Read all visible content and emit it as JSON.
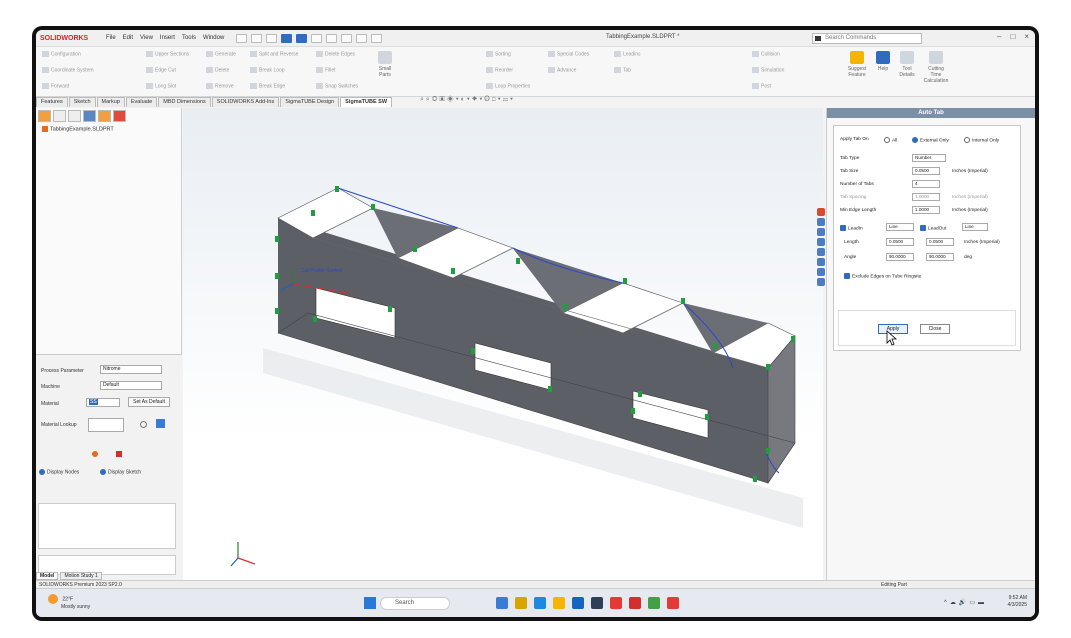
{
  "app": {
    "logo": "SOLIDWORKS",
    "menu": [
      "File",
      "Edit",
      "View",
      "Insert",
      "Tools",
      "Window"
    ],
    "doc_title": "TabbingExample.SLDPRT *",
    "search_placeholder": "Search Commands",
    "window_controls": [
      "–",
      "□",
      "×"
    ]
  },
  "ribbon": {
    "small_buttons": [
      "Configuration",
      "Coordinate System",
      "Forward",
      "Upper Sections",
      "Edge Cut",
      "Long Slot",
      "Generate",
      "Delete",
      "Remove",
      "Split and Reverse",
      "Break Loop",
      "Break Edge",
      "Delete Edges",
      "Fillet",
      "Snap Switches",
      "Sorting",
      "Reorder",
      "Loop Properties",
      "Special Codes",
      "Advance",
      "Leadins",
      "Tab",
      "Collision",
      "Simulation",
      "Post"
    ],
    "large_buttons": [
      {
        "label": "Small Parts",
        "style": ""
      },
      {
        "label": "Suggest Feature",
        "style": "active"
      },
      {
        "label": "Help",
        "style": "blue"
      },
      {
        "label": "Tool Details",
        "style": ""
      },
      {
        "label": "Cutting Time Calculation",
        "style": ""
      }
    ]
  },
  "tabs": [
    "Features",
    "Sketch",
    "Markup",
    "Evaluate",
    "MBD Dimensions",
    "SOLIDWORKS Add-Ins",
    "SigmaTUBE Design",
    "SigmaTUBE SW"
  ],
  "active_tab": "SigmaTUBE SW",
  "tree": {
    "root": "TabbingExample.SLDPRT"
  },
  "process": {
    "process_parameter_label": "Process Parameter",
    "process_parameter_value": "Nitrome",
    "machine_label": "Machine",
    "machine_value": "Default",
    "material_label": "Material",
    "material_value": "SS",
    "set_as_default": "Set As Default",
    "material_lookup_label": "Material Lookup",
    "display_nodes": "Display Nodes",
    "display_sketch": "Display Sketch"
  },
  "viewport": {
    "annotation": "Cut Profile: Sorted"
  },
  "auto_tab": {
    "title": "Auto Tab",
    "apply_tab_on_label": "Apply Tab On",
    "options": [
      "All",
      "External Only",
      "Internal Only"
    ],
    "selected_option": "External Only",
    "tab_type_label": "Tab Type",
    "tab_type_value": "Number",
    "tab_size_label": "Tab Size",
    "tab_size_value": "0.0500",
    "tab_size_unit": "Inches (Imperial)",
    "num_tabs_label": "Number of Tabs",
    "num_tabs_value": "4",
    "tab_spacing_label": "Tab Spacing",
    "tab_spacing_value": "1.0000",
    "tab_spacing_unit": "Inches (Imperial)",
    "min_edge_label": "Min Edge Length",
    "min_edge_value": "1.0000",
    "min_edge_unit": "Inches (Imperial)",
    "leadin_label": "LeadIn",
    "leadin_value": "Line",
    "leadout_label": "LeadOut",
    "leadout_value": "Line",
    "length_label": "Length",
    "length_in": "0.0500",
    "length_out": "0.0500",
    "length_unit": "Inches (Imperial)",
    "angle_label": "Angle",
    "angle_in": "90.0000",
    "angle_out": "90.0000",
    "angle_unit": "deg",
    "exclude_label": "Exclude Edges on Tube Ringsite",
    "apply": "Apply",
    "close": "Close"
  },
  "status": {
    "left": "SOLIDWORKS Premium 2023 SP2.0",
    "center": "Editing Part",
    "bottom_tabs": [
      "Model",
      "Motion Study 1"
    ]
  },
  "taskbar": {
    "weather_temp": "22°F",
    "weather_text": "Mostly sunny",
    "search": "Search",
    "time": "9:52 AM",
    "date": "4/3/2025",
    "app_colors": [
      "#3a7bd5",
      "#d8a400",
      "#1e88e5",
      "#f4b400",
      "#1565c0",
      "#2e4057",
      "#e53935",
      "#d32f2f",
      "#43a047",
      "#e53935"
    ]
  }
}
